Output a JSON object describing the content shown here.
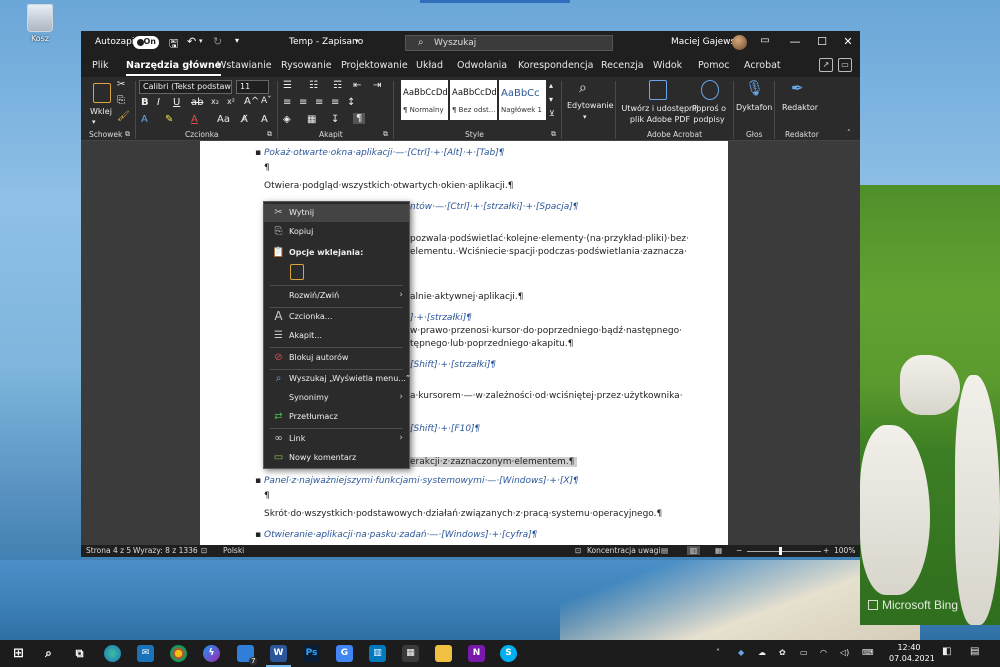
{
  "desktop": {
    "recycle_bin_label": "Kosz",
    "bing_watermark": "Microsoft Bing"
  },
  "titlebar": {
    "autosave_label": "Autozapis",
    "autosave_state": "On",
    "document_title": "Temp - Zapisano",
    "search_placeholder": "Wyszukaj",
    "user_name": "Maciej Gajewski"
  },
  "tabs": [
    "Plik",
    "Narzędzia główne",
    "Wstawianie",
    "Rysowanie",
    "Projektowanie",
    "Układ",
    "Odwołania",
    "Korespondencja",
    "Recenzja",
    "Widok",
    "Pomoc",
    "Acrobat"
  ],
  "ribbon": {
    "paste_label": "Wklej",
    "font_name": "Calibri (Tekst podstawo",
    "font_size": "11",
    "styles": [
      {
        "preview": "AaBbCcDd",
        "name": "¶ Normalny"
      },
      {
        "preview": "AaBbCcDd",
        "name": "¶ Bez odst..."
      },
      {
        "preview": "AaBbCc",
        "name": "Nagłówek 1"
      }
    ],
    "editing_label": "Edytowanie",
    "adobe_create_label": "Utwórz i udostępnij plik Adobe PDF",
    "adobe_sign_label": "Poproś o podpisy",
    "dictate_label": "Dyktafon",
    "editor_label": "Redaktor",
    "groups": {
      "clipboard": "Schowek",
      "font": "Czcionka",
      "paragraph": "Akapit",
      "styles": "Style",
      "adobe": "Adobe Acrobat",
      "voice": "Głos",
      "editor": "Redaktor"
    }
  },
  "document": {
    "lines": [
      "Pokaż·otwarte·okna·aplikacji·—·[Ctrl]·+·[Alt]·+·[Tab]¶",
      "¶",
      "Otwiera·podgląd·wszystkich·otwartych·okien·aplikacji.¶",
      "ntów·—·[Ctrl]·+·[strzałki]·+·[Spacja]¶",
      "pozwala·podświetlać·kolejne·elementy·(na·przykład·pliki)·bez·",
      "elementu.·Wciśniecie·spacji·podczas·podświetlania·zaznacza·",
      "alnie·aktywnej·aplikacji.¶",
      "]·+·[strzałki]¶",
      "w·prawo·przenosi·kursor·do·poprzedniego·bądź·następnego·",
      "tępnego·lub·poprzedniego·akapitu.¶",
      "[Shift]·+·[strzałki]¶",
      "a·kursorem·—·w·zależności·od·wciśniętej·przez·użytkownika·",
      "[Shift]·+·[F10]¶",
      "erakcji·z·zaznaczonym·elementem.¶",
      "Panel·z·najważniejszymi·funkcjami·systemowymi·—·[Windows]·+·[X]¶",
      "¶",
      "Skrót·do·wszystkich·podstawowych·działań·związanych·z·pracą·systemu·operacyjnego.¶",
      "Otwieranie·aplikacji·na·pasku·zadań·—·[Windows]·+·[cyfra]¶"
    ]
  },
  "context_menu": {
    "items": [
      {
        "label": "Wytnij",
        "icon": "scissors-icon"
      },
      {
        "label": "Kopiuj",
        "icon": "copy-icon"
      },
      {
        "label": "Opcje wklejania:",
        "icon": "paste-icon"
      },
      {
        "label": "Rozwiń/Zwiń",
        "icon": ""
      },
      {
        "label": "Czcionka...",
        "icon": "font-icon"
      },
      {
        "label": "Akapit...",
        "icon": "paragraph-icon"
      },
      {
        "label": "Blokuj autorów",
        "icon": "block-authors-icon"
      },
      {
        "label": "Wyszukaj „Wyświetla menu...”",
        "icon": "search-icon"
      },
      {
        "label": "Synonimy",
        "icon": ""
      },
      {
        "label": "Przetłumacz",
        "icon": "translate-icon"
      },
      {
        "label": "Link",
        "icon": "link-icon"
      },
      {
        "label": "Nowy komentarz",
        "icon": "comment-icon"
      }
    ]
  },
  "statusbar": {
    "page": "Strona 4 z 5",
    "words": "Wyrazy: 8 z 1336",
    "language": "Polski",
    "focus": "Koncentracja uwagi",
    "zoom": "100%"
  },
  "taskbar": {
    "time": "12:40",
    "date": "07.04.2021",
    "badge_count": "7"
  },
  "colors": {
    "word_blue": "#2b579a",
    "accent": "#76b9ed",
    "dark_bg": "#1f1f1f"
  }
}
